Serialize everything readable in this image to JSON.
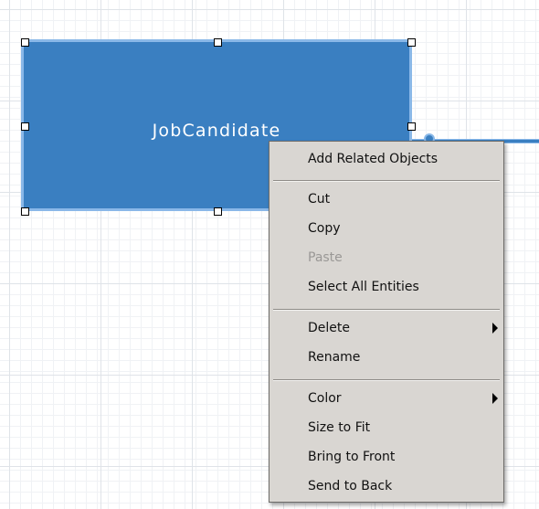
{
  "diagram": {
    "entity": {
      "name": "JobCandidate",
      "fill_color": "#3a7fc1",
      "border_color": "#8ab8e8",
      "text_color": "#ffffff",
      "selected": true
    }
  },
  "context_menu": {
    "background_color": "#d9d6d2",
    "items": [
      {
        "label": "Add Related Objects",
        "enabled": true
      },
      {
        "label": "Cut",
        "enabled": true
      },
      {
        "label": "Copy",
        "enabled": true
      },
      {
        "label": "Paste",
        "enabled": false
      },
      {
        "label": "Select All Entities",
        "enabled": true
      },
      {
        "label": "Delete",
        "enabled": true,
        "submenu": true,
        "submenu_icon": "triangle-right-icon"
      },
      {
        "label": "Rename",
        "enabled": true
      },
      {
        "label": "Color",
        "enabled": true,
        "submenu": true,
        "submenu_icon": "triangle-right-icon"
      },
      {
        "label": "Size to Fit",
        "enabled": true
      },
      {
        "label": "Bring to Front",
        "enabled": true
      },
      {
        "label": "Send to Back",
        "enabled": true
      }
    ]
  }
}
